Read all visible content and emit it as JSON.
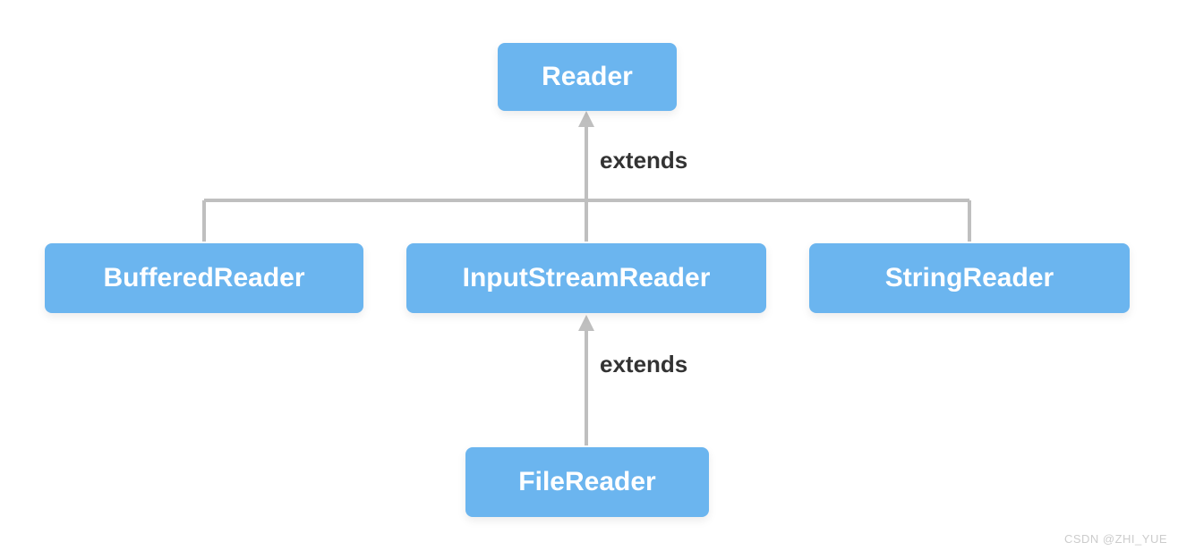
{
  "nodes": {
    "root": "Reader",
    "child1": "BufferedReader",
    "child2": "InputStreamReader",
    "child3": "StringReader",
    "grandchild": "FileReader"
  },
  "labels": {
    "extends1": "extends",
    "extends2": "extends"
  },
  "watermark": "CSDN @ZHI_YUE",
  "colors": {
    "node_bg": "#6bb5ef",
    "node_text": "#ffffff",
    "connector": "#bfbfbf",
    "label_text": "#333333"
  }
}
